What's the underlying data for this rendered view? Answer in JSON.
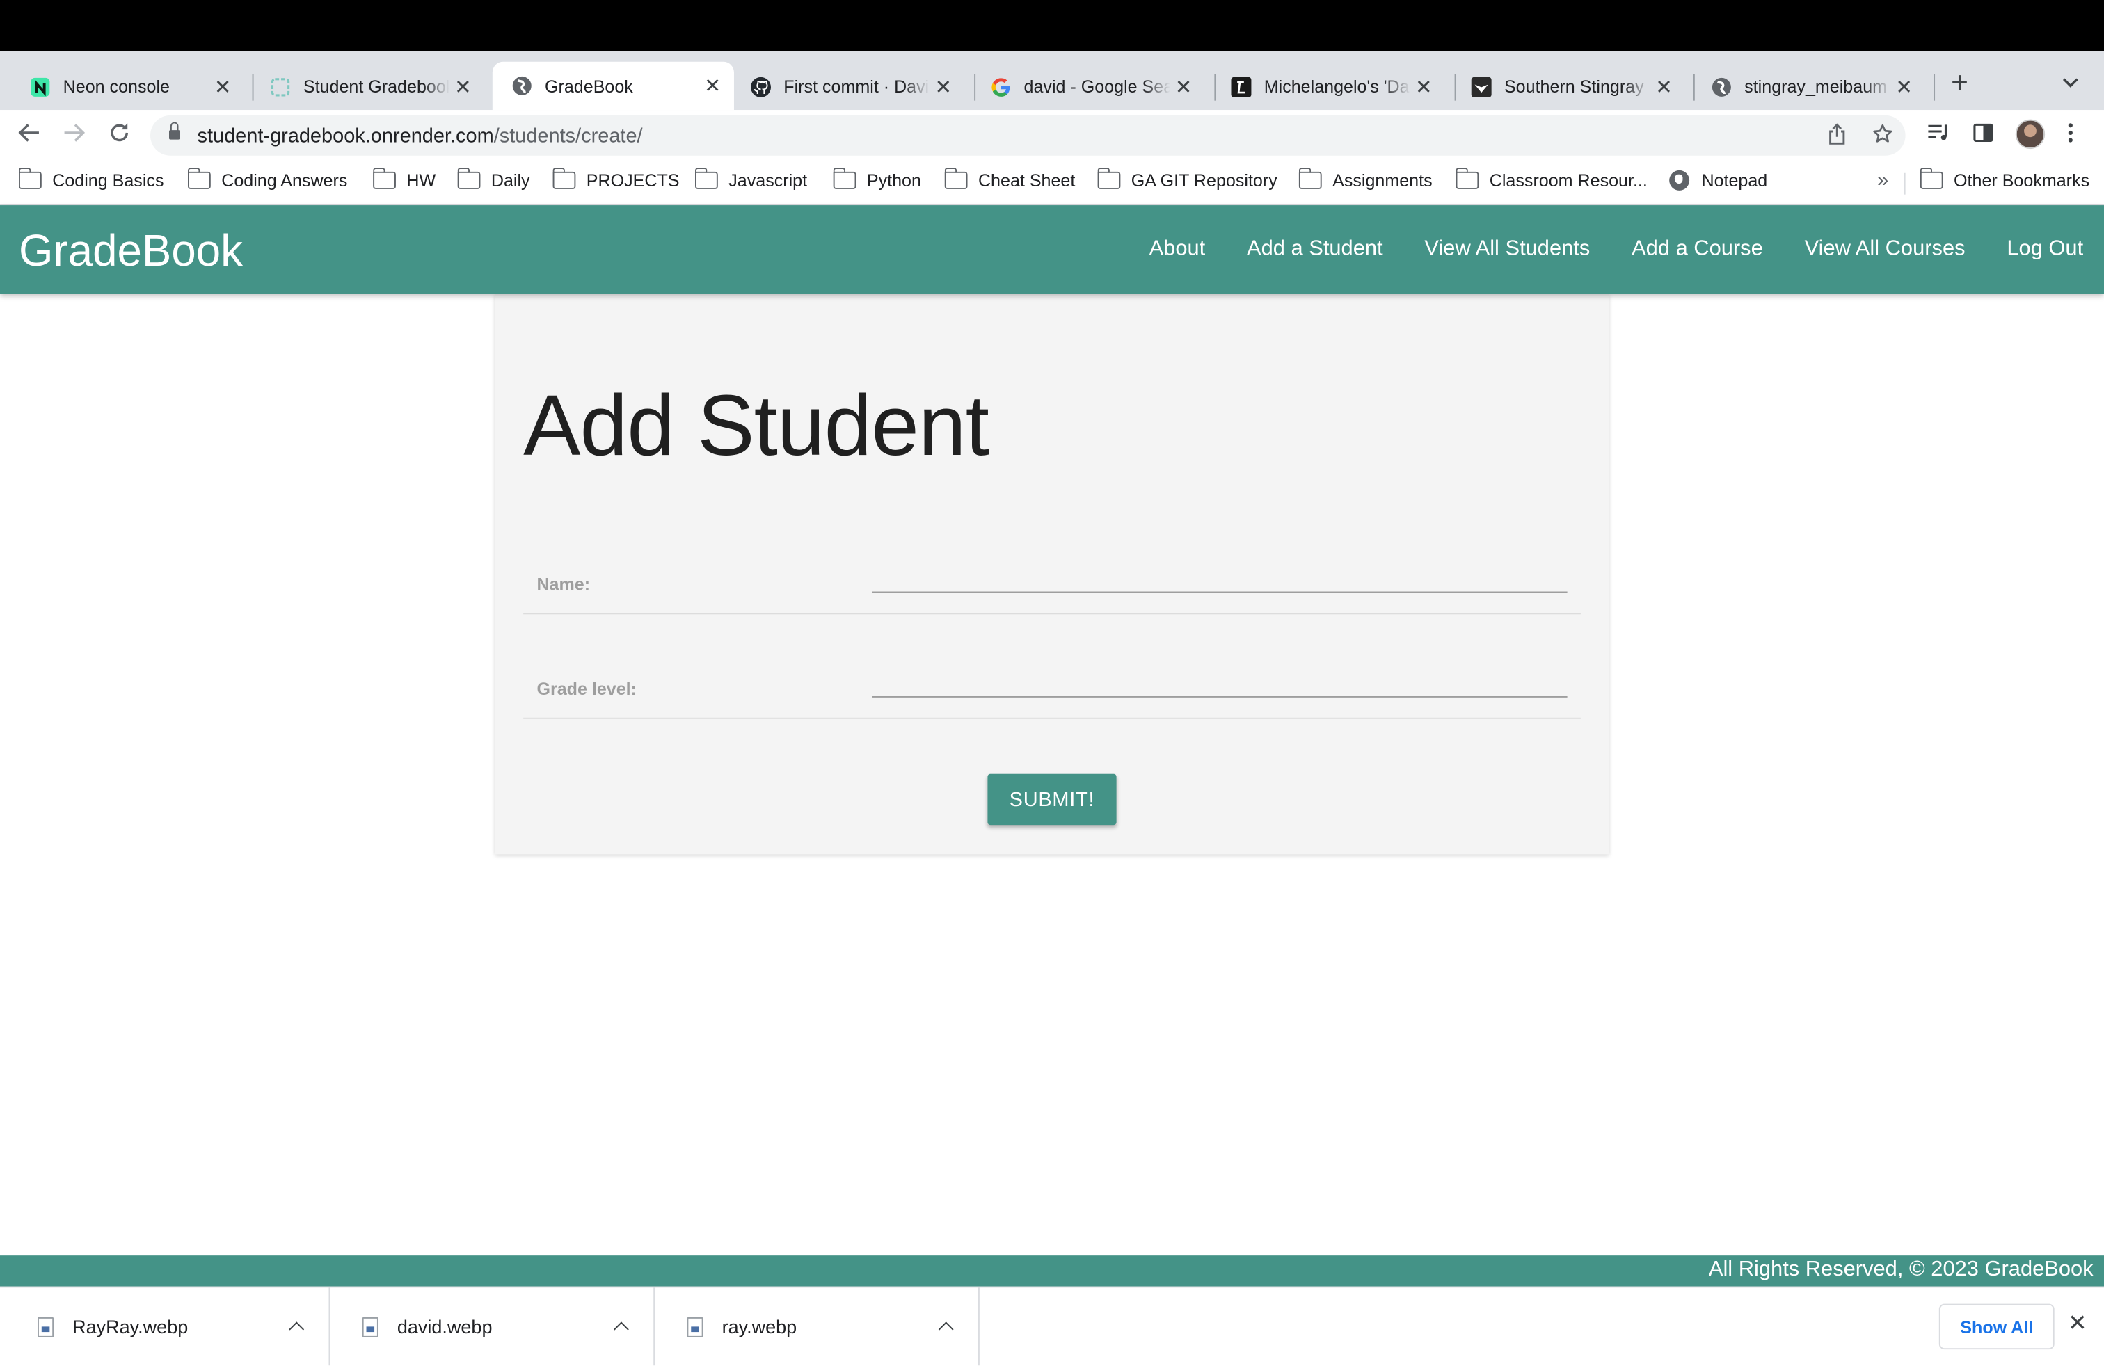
{
  "browser": {
    "tabs": [
      {
        "title": "Neon console",
        "favicon": "neon-icon",
        "active": false
      },
      {
        "title": "Student Gradebook",
        "favicon": "render-icon",
        "active": false
      },
      {
        "title": "GradeBook",
        "favicon": "globe-icon",
        "active": true
      },
      {
        "title": "First commit · David",
        "favicon": "github-icon",
        "active": false
      },
      {
        "title": "david - Google Search",
        "favicon": "google-icon",
        "active": false
      },
      {
        "title": "Michelangelo's 'David'",
        "favicon": "site-icon",
        "active": false
      },
      {
        "title": "Southern Stingray",
        "favicon": "stingray-site-icon",
        "active": false
      },
      {
        "title": "stingray_meibaum",
        "favicon": "globe-icon",
        "active": false
      }
    ],
    "tab_close_glyph": "✕",
    "new_tab_glyph": "+",
    "url_host": "student-gradebook.onrender.com",
    "url_path": "/students/create/",
    "bookmarks": [
      {
        "label": "Coding Basics",
        "icon": "folder-icon"
      },
      {
        "label": "Coding Answers",
        "icon": "folder-icon"
      },
      {
        "label": "HW",
        "icon": "folder-icon"
      },
      {
        "label": "Daily",
        "icon": "folder-icon"
      },
      {
        "label": "PROJECTS",
        "icon": "folder-icon"
      },
      {
        "label": "Javascript",
        "icon": "folder-icon"
      },
      {
        "label": "Python",
        "icon": "folder-icon"
      },
      {
        "label": "Cheat Sheet",
        "icon": "folder-icon"
      },
      {
        "label": "GA GIT Repository",
        "icon": "folder-icon"
      },
      {
        "label": "Assignments",
        "icon": "folder-icon"
      },
      {
        "label": "Classroom Resour...",
        "icon": "folder-icon"
      },
      {
        "label": "Notepad",
        "icon": "globe-icon"
      }
    ],
    "bookmarks_overflow": "»",
    "other_bookmarks": "Other Bookmarks"
  },
  "app": {
    "brand": "GradeBook",
    "nav": [
      "About",
      "Add a Student",
      "View All Students",
      "Add a Course",
      "View All Courses",
      "Log Out"
    ],
    "accent_color": "#449387"
  },
  "form": {
    "title": "Add Student",
    "fields": [
      {
        "label": "Name:",
        "value": ""
      },
      {
        "label": "Grade level:",
        "value": ""
      }
    ],
    "submit_label": "SUBMIT!"
  },
  "footer": {
    "text": "All Rights Reserved, © 2023 GradeBook"
  },
  "downloads": {
    "items": [
      "RayRay.webp",
      "david.webp",
      "ray.webp"
    ],
    "show_all_label": "Show All",
    "close_glyph": "✕"
  }
}
